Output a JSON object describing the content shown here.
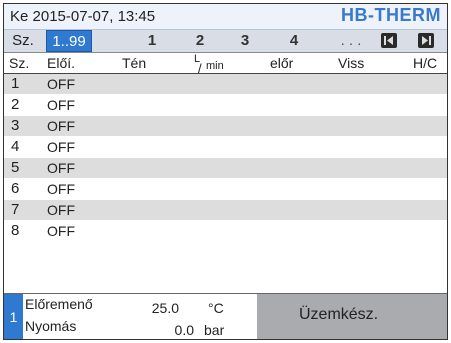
{
  "header": {
    "datetime": "Ke  2015-07-07, 13:45",
    "logo": "HB-THERM"
  },
  "tabs": {
    "sz_label": "Sz.",
    "range_label": "1..99",
    "items": [
      "1",
      "2",
      "3",
      "4"
    ],
    "more": ". . ."
  },
  "table": {
    "columns": [
      "Sz.",
      "Előí.",
      "Tén",
      "L/min",
      "előr",
      "Viss",
      "H/C"
    ],
    "flow_unit_top": "L",
    "flow_unit_bottom": "min",
    "rows": [
      {
        "no": "1",
        "status": "OFF"
      },
      {
        "no": "2",
        "status": "OFF"
      },
      {
        "no": "3",
        "status": "OFF"
      },
      {
        "no": "4",
        "status": "OFF"
      },
      {
        "no": "5",
        "status": "OFF"
      },
      {
        "no": "6",
        "status": "OFF"
      },
      {
        "no": "7",
        "status": "OFF"
      },
      {
        "no": "8",
        "status": "OFF"
      }
    ]
  },
  "footer": {
    "unit_number": "1",
    "forward_label": "Előremenő",
    "forward_value": "25.0",
    "forward_unit": "°C",
    "pressure_label": "Nyomás",
    "pressure_value": "0.0",
    "pressure_unit": "bar",
    "status": "Üzemkész."
  },
  "colors": {
    "accent": "#2f7ad0",
    "logo": "#3a79c8",
    "status_panel": "#a9abae",
    "row_alt": "#dddddd"
  }
}
